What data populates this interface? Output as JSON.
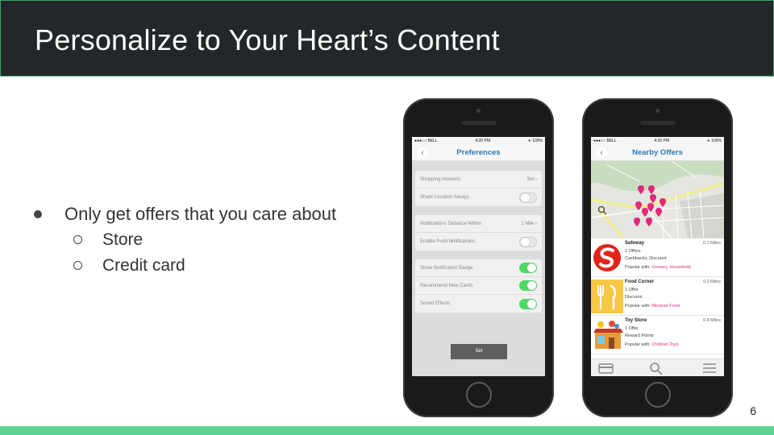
{
  "slide": {
    "title": "Personalize to Your Heart’s Content",
    "page_number": "6",
    "bullets": {
      "main": "Only get offers that you care about",
      "sub": [
        "Store",
        "Credit card"
      ]
    },
    "colors": {
      "title_bg": "#222829",
      "footer_bar": "#5fd394",
      "accent_blue": "#2a7ab8",
      "accent_pink": "#e3287a",
      "toggle_on": "#4cd964"
    }
  },
  "status_bar": {
    "carrier": "●●●○○ BELL",
    "time": "4:20 PM",
    "battery": "100%"
  },
  "preferences": {
    "back_icon": "chevron-left-icon",
    "title": "Preferences",
    "groups": [
      [
        {
          "label": "Shopping Interests",
          "value": "Set",
          "control": "chevron"
        },
        {
          "label": "Share Location Always",
          "control": "toggle",
          "on": false
        }
      ],
      [
        {
          "label": "Notifications Distance Within",
          "value": "1 Mile",
          "control": "chevron"
        },
        {
          "label": "Enable Push Notifications",
          "control": "toggle",
          "on": false
        }
      ],
      [
        {
          "label": "Show Notification Badge",
          "control": "toggle",
          "on": true
        },
        {
          "label": "Recommend New Cards",
          "control": "toggle",
          "on": true
        },
        {
          "label": "Sound Effects",
          "control": "toggle",
          "on": true
        }
      ]
    ],
    "button_label": "Set"
  },
  "nearby": {
    "title": "Nearby Offers",
    "popular_prefix": "Popular with:",
    "offers": [
      {
        "name": "Safeway",
        "distance": "0.1 Miles",
        "count": "2 Offers",
        "types": "Cashbacks, Discount",
        "popular": "Grocery, Household",
        "logo_icon": "safeway-logo-icon"
      },
      {
        "name": "Food Corner",
        "distance": "0.3 Miles",
        "count": "1 Offer",
        "types": "Discount",
        "popular": "Mexican Food",
        "logo_icon": "fork-knife-icon"
      },
      {
        "name": "Toy Store",
        "distance": "0.4 Miles",
        "count": "1 Offer",
        "types": "Reward Points",
        "popular": "Children Toys",
        "logo_icon": "toy-store-icon"
      }
    ],
    "tab_icons": [
      "credit-card-icon",
      "search-icon",
      "menu-icon"
    ]
  }
}
